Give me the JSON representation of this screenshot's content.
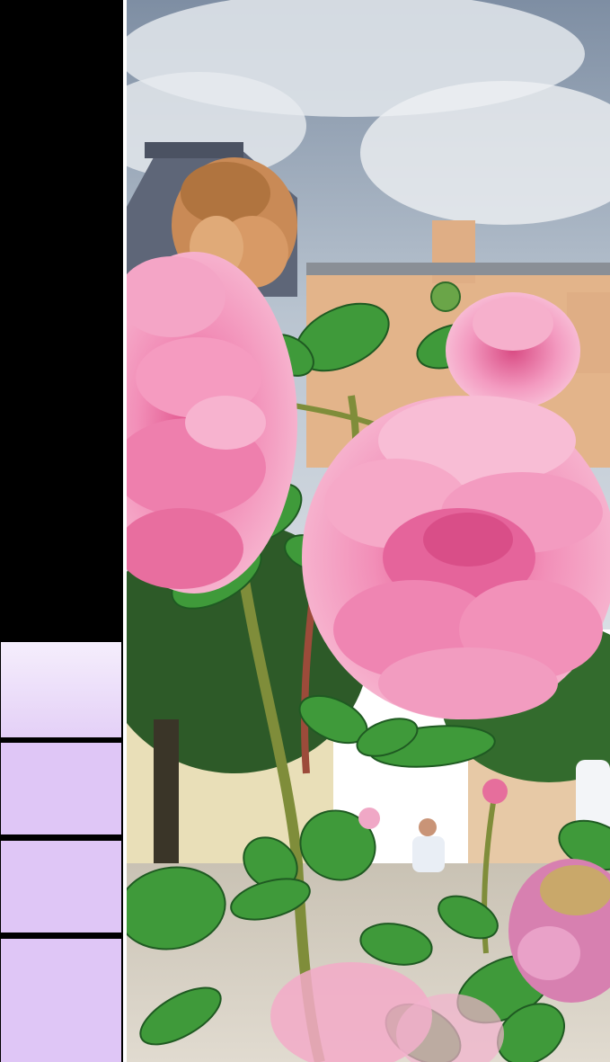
{
  "sidebar": {
    "background": "#000000",
    "swatches": [
      "#efe3fa",
      "#dfc6f6",
      "#dfc6f6",
      "#dfc6f6"
    ]
  },
  "photo": {
    "subject": "pink-roses-photo",
    "palette": {
      "sky": "#aebccb",
      "cloud": "#dfe3e8",
      "building": "#e4b98f",
      "roof": "#5f6778",
      "rose": "#f08bb5",
      "rose_dark": "#d95a8c",
      "dried_rose": "#c98a56",
      "leaf": "#3f9a3a",
      "leaf_dark": "#1f5a22",
      "stem": "#7a8a3a"
    }
  }
}
